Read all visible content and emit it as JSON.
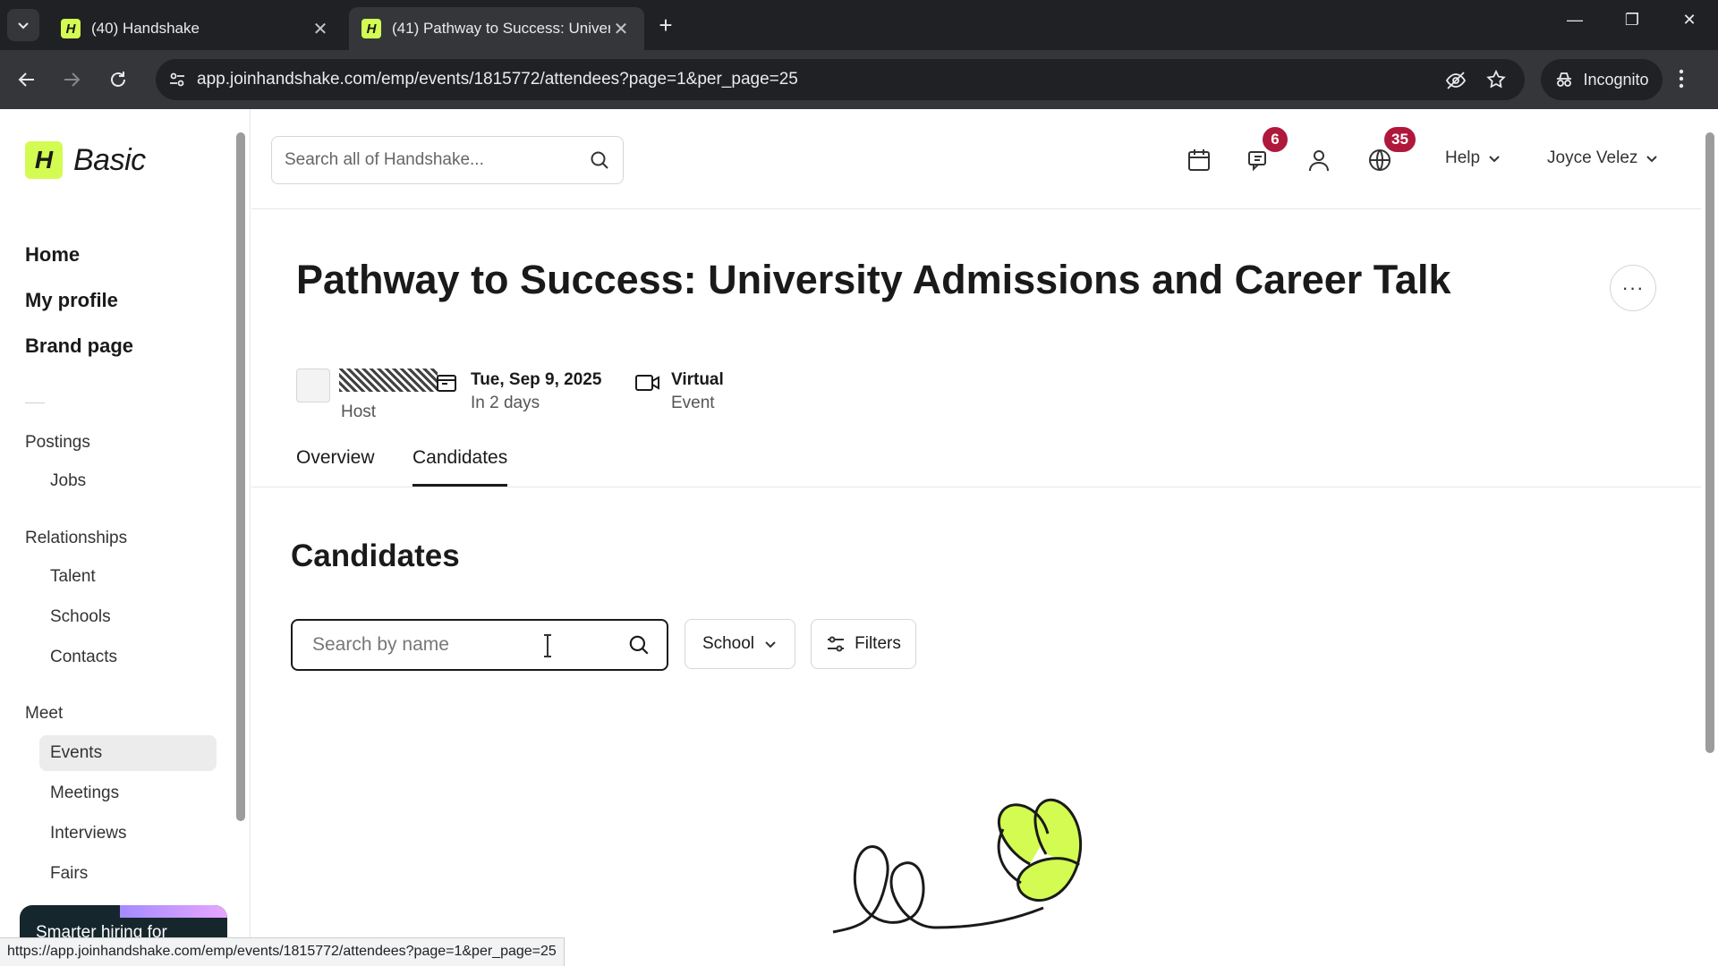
{
  "browser": {
    "tabs": [
      {
        "title": "(40) Handshake",
        "favicon": "H"
      },
      {
        "title": "(41) Pathway to Success: Univer",
        "favicon": "H"
      }
    ],
    "url": "app.joinhandshake.com/emp/events/1815772/attendees?page=1&per_page=25",
    "incognito_label": "Incognito",
    "status_url": "https://app.joinhandshake.com/emp/events/1815772/attendees?page=1&per_page=25"
  },
  "sidebar": {
    "logo_mark": "H",
    "logo_text": "Basic",
    "primary": [
      {
        "label": "Home"
      },
      {
        "label": "My profile"
      },
      {
        "label": "Brand page"
      }
    ],
    "sections": [
      {
        "title": "Postings",
        "items": [
          "Jobs"
        ]
      },
      {
        "title": "Relationships",
        "items": [
          "Talent",
          "Schools",
          "Contacts"
        ]
      },
      {
        "title": "Meet",
        "items": [
          "Events",
          "Meetings",
          "Interviews",
          "Fairs"
        ]
      }
    ],
    "selected_item": "Events",
    "promo_text": "Smarter hiring for"
  },
  "topbar": {
    "search_placeholder": "Search all of Handshake...",
    "messages_badge": "6",
    "notifications_badge": "35",
    "help_label": "Help",
    "user_name": "Joyce Velez"
  },
  "event": {
    "title": "Pathway to Success: University Admissions and Career Talk",
    "host_label": "Host",
    "date": "Tue, Sep 9, 2025",
    "date_relative": "In 2 days",
    "location_type": "Virtual",
    "location_sub": "Event",
    "more_label": "···"
  },
  "tabs": [
    {
      "label": "Overview"
    },
    {
      "label": "Candidates"
    }
  ],
  "active_tab": "Candidates",
  "candidates": {
    "title": "Candidates",
    "search_placeholder": "Search by name",
    "school_label": "School",
    "filters_label": "Filters"
  },
  "colors": {
    "brand_green": "#d3fb52",
    "badge_red": "#b0183b",
    "chrome_dark": "#202124"
  }
}
